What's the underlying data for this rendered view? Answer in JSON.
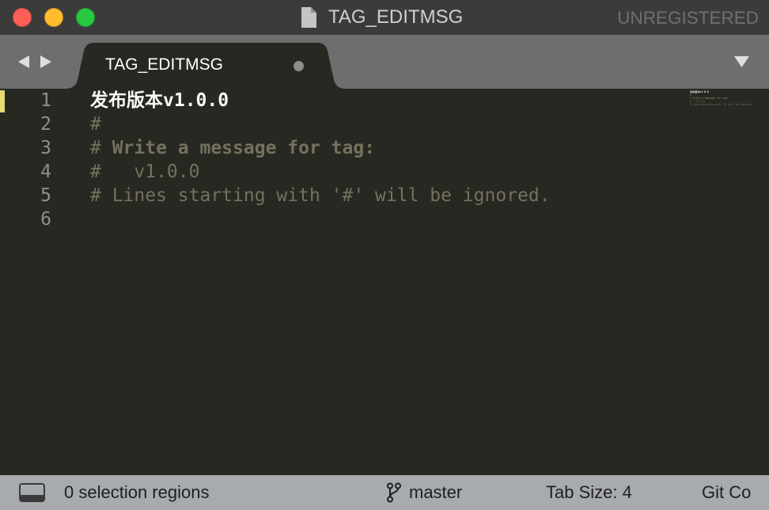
{
  "window": {
    "title": "TAG_EDITMSG",
    "registration_status": "UNREGISTERED"
  },
  "tab_bar": {
    "tabs": [
      {
        "label": "TAG_EDITMSG",
        "active": true,
        "modified": true
      }
    ]
  },
  "editor": {
    "modified_line": 1,
    "lines": [
      {
        "number": 1,
        "tokens": [
          {
            "text": "发布版本v1.0.0"
          }
        ]
      },
      {
        "number": 2,
        "tokens": [
          {
            "text": "#"
          }
        ]
      },
      {
        "number": 3,
        "tokens": [
          {
            "text": "# "
          },
          {
            "text": "Write a message for tag:"
          }
        ]
      },
      {
        "number": 4,
        "tokens": [
          {
            "text": "#   v1.0.0"
          }
        ]
      },
      {
        "number": 5,
        "tokens": [
          {
            "text": "# Lines starting with '#' will be ignored."
          }
        ]
      },
      {
        "number": 6,
        "tokens": []
      }
    ]
  },
  "status_bar": {
    "selection": "0 selection regions",
    "branch": "master",
    "tab_size": "Tab Size: 4",
    "syntax": "Git Co"
  },
  "icons": {
    "title_file": "file-icon",
    "nav_back": "triangle-left-icon",
    "nav_forward": "triangle-right-icon",
    "tab_modified": "dot-icon",
    "tab_list": "triangle-down-icon",
    "panel_toggle": "panel-icon",
    "branch": "git-branch-icon"
  },
  "colors": {
    "title_bar": "#3b3b3b",
    "title_text": "#cfcfcf",
    "title_icon": "#c4c4c4",
    "title_icon_fold": "#8f8f8f",
    "unregistered_text": "#707070",
    "close_button": "#ff5f57",
    "minimize_button": "#febc2e",
    "zoom_button": "#28c840",
    "tab_bar": "#6e6e6e",
    "tab_active": "#272822",
    "tab_text": "#ffffff",
    "tab_dot": "#8e8e8e",
    "tab_bar_glyph": "#dedede",
    "editor_background": "#272822",
    "text": "#f8f8f2",
    "comment": "#75715e",
    "line_number": "#90908a",
    "modified_marker": "#e6db74",
    "status_bar": "#a7aaaf",
    "status_text": "#1f1f1f"
  }
}
